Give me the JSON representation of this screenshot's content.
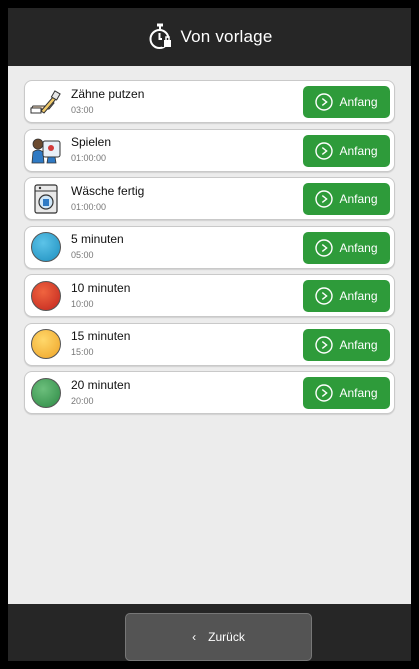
{
  "header": {
    "title": "Von vorlage",
    "icon": "stopwatch-icon"
  },
  "items": [
    {
      "name": "Zähne putzen",
      "duration": "03:00",
      "icon": "toothbrush-icon",
      "button": "Anfang"
    },
    {
      "name": "Spielen",
      "duration": "01:00:00",
      "icon": "children-playing-icon",
      "button": "Anfang"
    },
    {
      "name": "Wäsche fertig",
      "duration": "01:00:00",
      "icon": "washing-machine-icon",
      "button": "Anfang"
    },
    {
      "name": "5 minuten",
      "duration": "05:00",
      "icon": "blue-circle-icon",
      "color": "#2fa3cf",
      "button": "Anfang"
    },
    {
      "name": "10 minuten",
      "duration": "10:00",
      "icon": "red-circle-icon",
      "color": "#d9302a",
      "button": "Anfang"
    },
    {
      "name": "15 minuten",
      "duration": "15:00",
      "icon": "yellow-circle-icon",
      "color": "#f3b93b",
      "button": "Anfang"
    },
    {
      "name": "20 minuten",
      "duration": "20:00",
      "icon": "green-circle-icon",
      "color": "#3c9a52",
      "button": "Anfang"
    }
  ],
  "footer": {
    "back_label": "Zurück"
  },
  "colors": {
    "header_bg": "#262626",
    "button_green": "#2e9b3a",
    "list_bg": "#ececec"
  }
}
